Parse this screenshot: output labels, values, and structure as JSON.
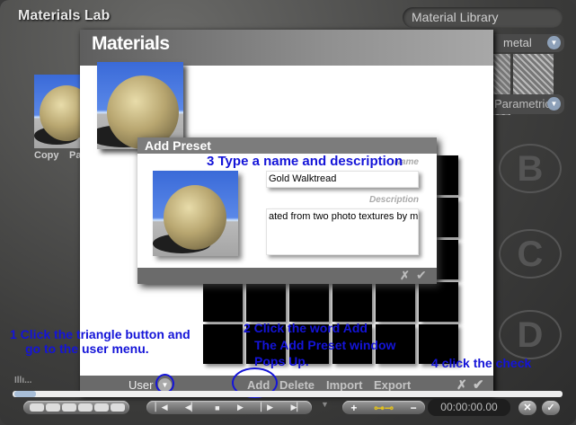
{
  "app": {
    "title": "Materials Lab",
    "library_label": "Material Library"
  },
  "right_panel": {
    "category": "metal",
    "type": "Parametric",
    "slots": [
      "B",
      "C",
      "D"
    ]
  },
  "left_bg": {
    "copy_label": "Copy",
    "paste_label": "Pa"
  },
  "materials": {
    "title": "Materials",
    "user_menu": "User",
    "actions": [
      "Add",
      "Delete",
      "Import",
      "Export"
    ]
  },
  "add_preset": {
    "title": "Add Preset",
    "name_label": "Name",
    "name_value": "Gold Walktread",
    "description_label": "Description",
    "description_value": "ated from two photo textures by me"
  },
  "annotations": {
    "step1a": "1 Click the triangle button and",
    "step1b": "go to the user menu.",
    "step2a": "2 Click the word Add",
    "step2b": "The Add Preset window",
    "step2c": "Pops Up.",
    "step3": "3 Type a name and description",
    "step4": "4 click the check"
  },
  "timeline": {
    "time": "00:00:00.00"
  }
}
